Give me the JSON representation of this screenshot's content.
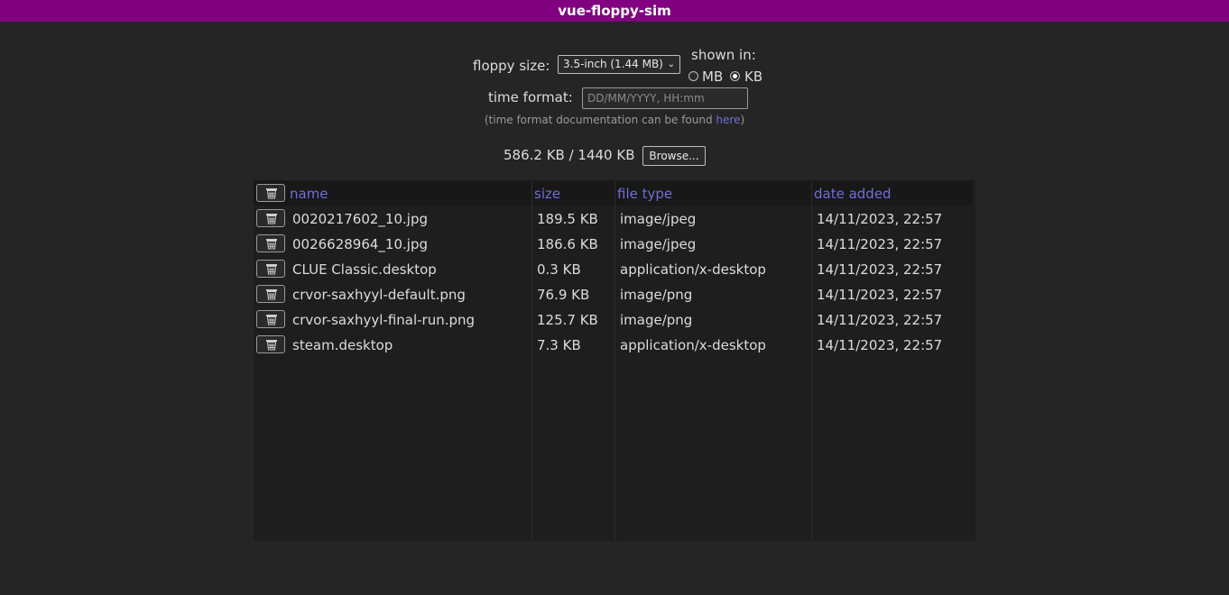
{
  "app": {
    "title": "vue-floppy-sim"
  },
  "settings": {
    "floppy_size_label": "floppy size:",
    "floppy_size_value": "3.5-inch (1.44 MB)",
    "shown_in_label": "shown in:",
    "unit_options": [
      "MB",
      "KB"
    ],
    "selected_unit": "KB",
    "time_format_label": "time format:",
    "time_format_placeholder": "DD/MM/YYYY, HH:mm",
    "hint_prefix": "(time format documentation can be found ",
    "hint_link": "here",
    "hint_suffix": ")"
  },
  "usage": {
    "text": "586.2 KB / 1440 KB",
    "browse_label": "Browse..."
  },
  "table": {
    "headers": [
      "name",
      "size",
      "file type",
      "date added"
    ],
    "rows": [
      {
        "name": "0020217602_10.jpg",
        "size": "189.5 KB",
        "type": "image/jpeg",
        "date": "14/11/2023, 22:57"
      },
      {
        "name": "0026628964_10.jpg",
        "size": "186.6 KB",
        "type": "image/jpeg",
        "date": "14/11/2023, 22:57"
      },
      {
        "name": "CLUE Classic.desktop",
        "size": "0.3 KB",
        "type": "application/x-desktop",
        "date": "14/11/2023, 22:57"
      },
      {
        "name": "crvor-saxhyyl-default.png",
        "size": "76.9 KB",
        "type": "image/png",
        "date": "14/11/2023, 22:57"
      },
      {
        "name": "crvor-saxhyyl-final-run.png",
        "size": "125.7 KB",
        "type": "image/png",
        "date": "14/11/2023, 22:57"
      },
      {
        "name": "steam.desktop",
        "size": "7.3 KB",
        "type": "application/x-desktop",
        "date": "14/11/2023, 22:57"
      }
    ]
  },
  "colors": {
    "title_bar": "#800080",
    "background": "#252525",
    "link": "#6f6fdc"
  }
}
